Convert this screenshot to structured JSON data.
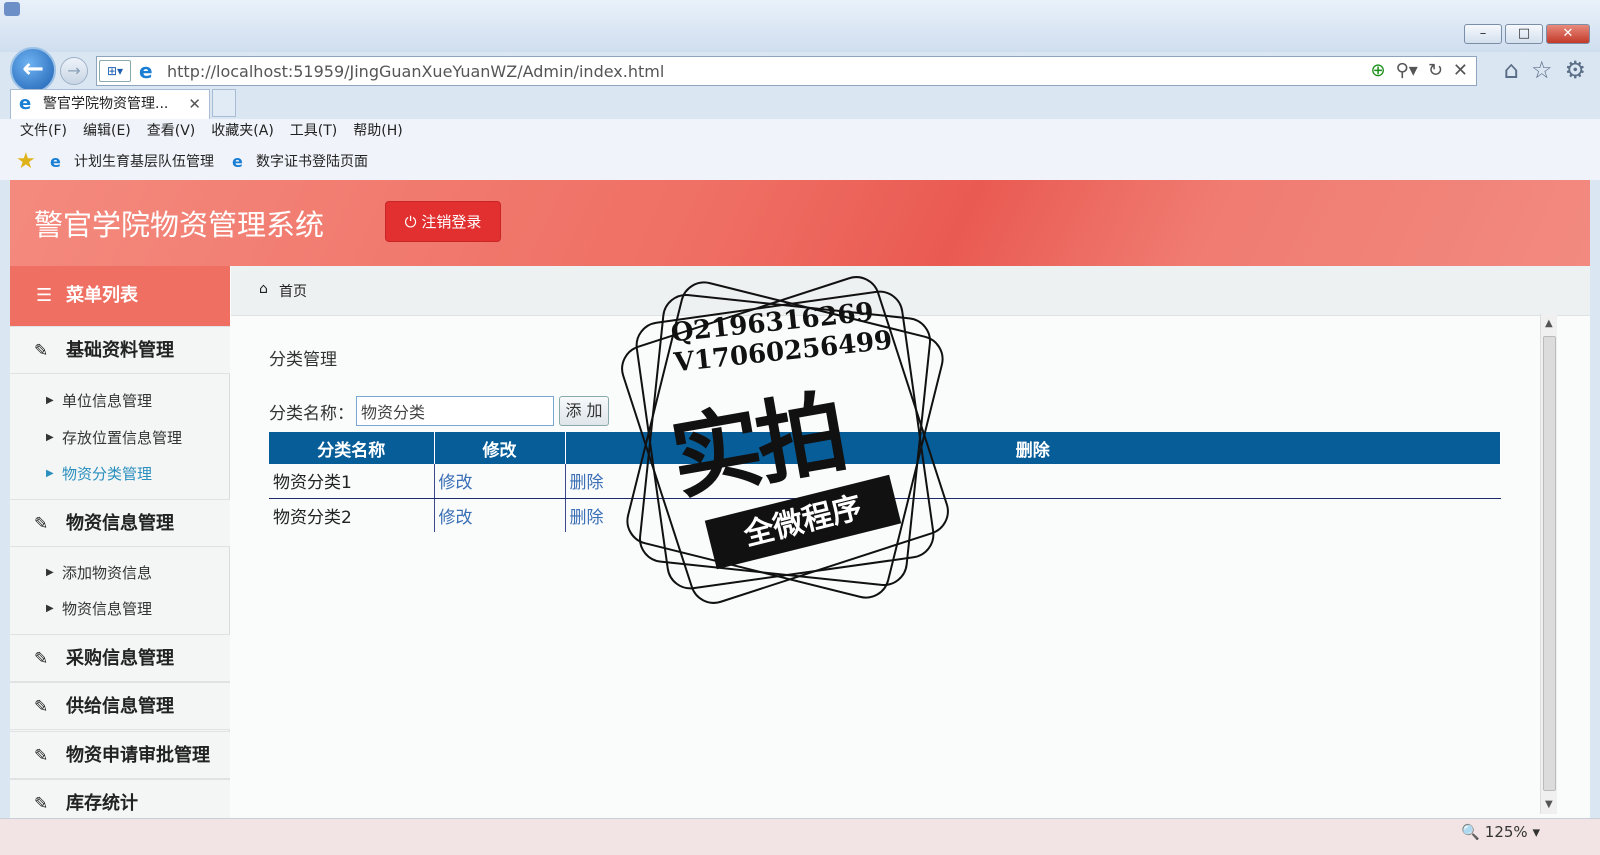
{
  "browser": {
    "url": "http://localhost:51959/JingGuanXueYuanWZ/Admin/index.html",
    "tab_title": "警官学院物资管理...",
    "menu": [
      "文件(F)",
      "编辑(E)",
      "查看(V)",
      "收藏夹(A)",
      "工具(T)",
      "帮助(H)"
    ],
    "favorites": [
      "计划生育基层队伍管理",
      "数字证书登陆页面"
    ],
    "zoom": "125%"
  },
  "header": {
    "title": "警官学院物资管理系统",
    "logout_label": "注销登录",
    "accent_color": "#ef6f62"
  },
  "sidebar": {
    "head": "菜单列表",
    "groups": [
      {
        "label": "基础资料管理",
        "items": [
          "单位信息管理",
          "存放位置信息管理",
          "物资分类管理"
        ]
      },
      {
        "label": "物资信息管理",
        "items": [
          "添加物资信息",
          "物资信息管理"
        ]
      },
      {
        "label": "采购信息管理"
      },
      {
        "label": "供给信息管理"
      },
      {
        "label": "物资申请审批管理"
      },
      {
        "label": "库存统计"
      }
    ],
    "active_item": "物资分类管理"
  },
  "breadcrumb": "首页",
  "main": {
    "section_title": "分类管理",
    "form_label": "分类名称：",
    "input_value": "物资分类",
    "add_label": "添 加",
    "table": {
      "headers": [
        "分类名称",
        "修改",
        "删除"
      ],
      "rows": [
        {
          "name": "物资分类1",
          "edit": "修改",
          "delete": "删除"
        },
        {
          "name": "物资分类2",
          "edit": "修改",
          "delete": "删除"
        }
      ]
    }
  },
  "watermark": {
    "qq": "Q2196316269",
    "wx": "V17060256499",
    "big": "实拍",
    "ribbon": "全微程序"
  }
}
